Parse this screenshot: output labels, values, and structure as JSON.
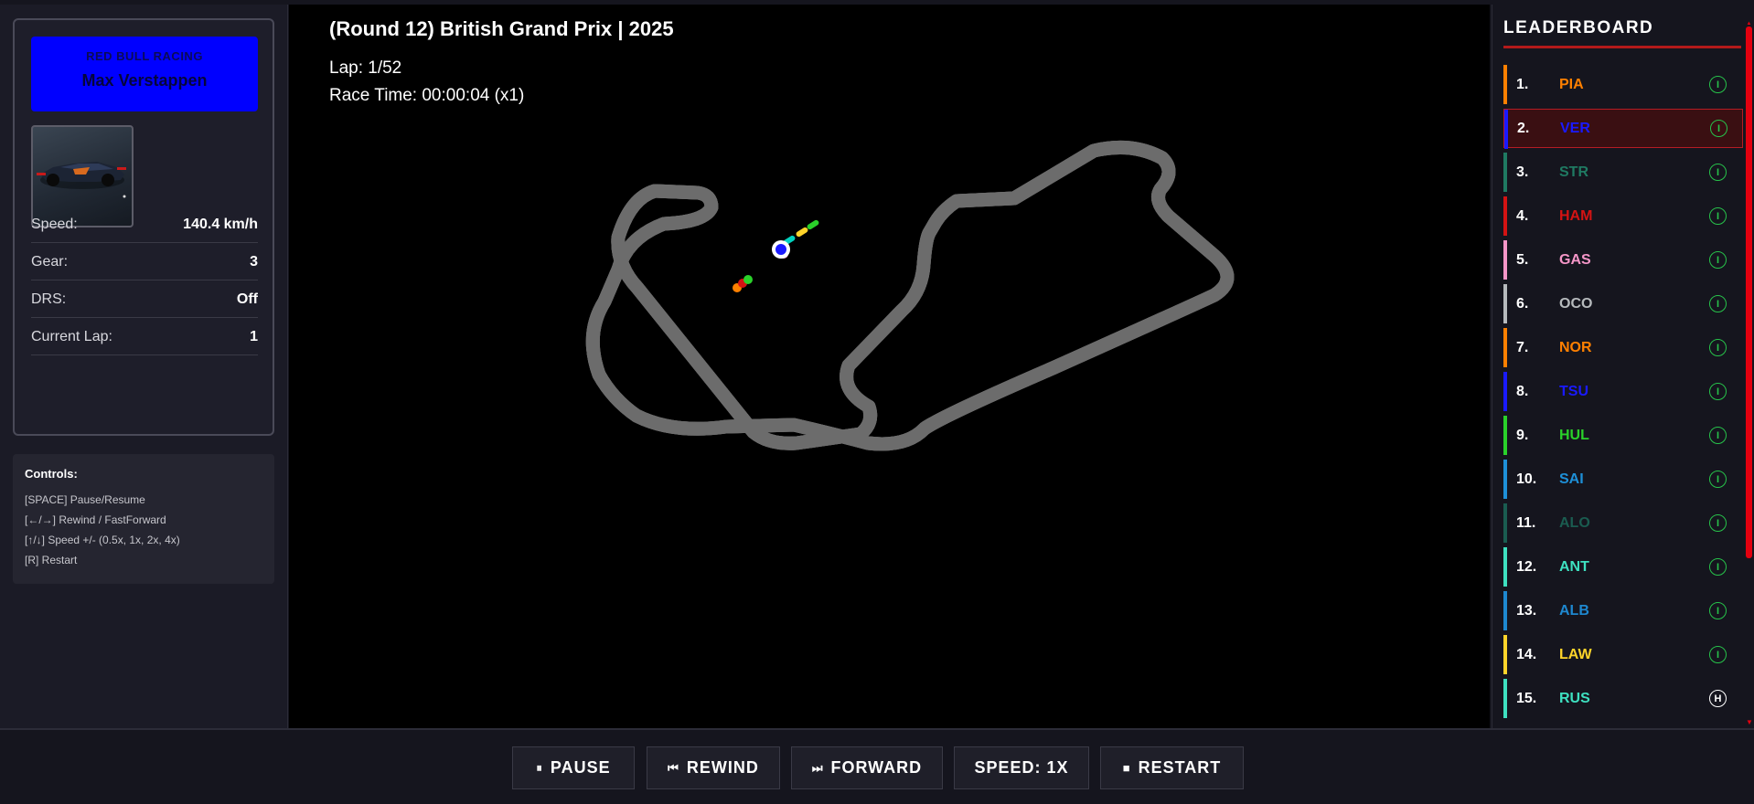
{
  "driver": {
    "team": "RED BULL RACING",
    "name": "Max Verstappen",
    "team_color": "#0000ff",
    "stats": [
      {
        "label": "Speed:",
        "value": "140.4 km/h"
      },
      {
        "label": "Gear:",
        "value": "3"
      },
      {
        "label": "DRS:",
        "value": "Off"
      },
      {
        "label": "Current Lap:",
        "value": "1"
      }
    ]
  },
  "controls": {
    "title": "Controls:",
    "lines": [
      "[SPACE] Pause/Resume",
      "[←/→] Rewind / FastForward",
      "[↑/↓] Speed +/- (0.5x, 1x, 2x, 4x)",
      "[R] Restart"
    ]
  },
  "race": {
    "title": "(Round 12) British Grand Prix | 2025",
    "lap": "Lap: 1/52",
    "time": "Race Time: 00:00:04 (x1)"
  },
  "leaderboard": {
    "title": "LEADERBOARD",
    "rows": [
      {
        "pos": "1.",
        "code": "PIA",
        "color": "#ff8000",
        "tyre": "I"
      },
      {
        "pos": "2.",
        "code": "VER",
        "color": "#1a1aff",
        "tyre": "I",
        "selected": true
      },
      {
        "pos": "3.",
        "code": "STR",
        "color": "#1f7a62",
        "tyre": "I"
      },
      {
        "pos": "4.",
        "code": "HAM",
        "color": "#d41313",
        "tyre": "I"
      },
      {
        "pos": "5.",
        "code": "GAS",
        "color": "#f596c8",
        "tyre": "I"
      },
      {
        "pos": "6.",
        "code": "OCO",
        "color": "#b6babd",
        "tyre": "I"
      },
      {
        "pos": "7.",
        "code": "NOR",
        "color": "#ff8000",
        "tyre": "I"
      },
      {
        "pos": "8.",
        "code": "TSU",
        "color": "#1a1aff",
        "tyre": "I"
      },
      {
        "pos": "9.",
        "code": "HUL",
        "color": "#2ad12a",
        "tyre": "I"
      },
      {
        "pos": "10.",
        "code": "SAI",
        "color": "#1e90d8",
        "tyre": "I"
      },
      {
        "pos": "11.",
        "code": "ALO",
        "color": "#1a5c50",
        "tyre": "I"
      },
      {
        "pos": "12.",
        "code": "ANT",
        "color": "#3ee0c0",
        "tyre": "I"
      },
      {
        "pos": "13.",
        "code": "ALB",
        "color": "#1e88d0",
        "tyre": "I"
      },
      {
        "pos": "14.",
        "code": "LAW",
        "color": "#ffd42a",
        "tyre": "I"
      },
      {
        "pos": "15.",
        "code": "RUS",
        "color": "#3ee0c0",
        "tyre": "H"
      }
    ]
  },
  "buttons": {
    "pause": "PAUSE",
    "rewind": "REWIND",
    "forward": "FORWARD",
    "speed": "SPEED: 1X",
    "restart": "RESTART"
  },
  "icons": {
    "pause": "pause-icon",
    "rewind": "rewind-icon",
    "forward": "fast-forward-icon",
    "restart": "stop-icon"
  }
}
